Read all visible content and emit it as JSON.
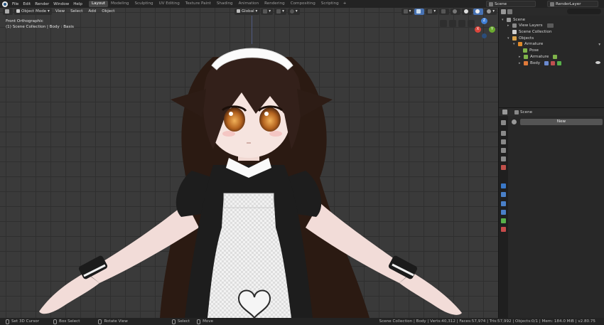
{
  "menu": [
    "File",
    "Edit",
    "Render",
    "Window",
    "Help"
  ],
  "workspaces": [
    {
      "label": "Layout",
      "active": true
    },
    {
      "label": "Modeling"
    },
    {
      "label": "Sculpting"
    },
    {
      "label": "UV Editing"
    },
    {
      "label": "Texture Paint"
    },
    {
      "label": "Shading"
    },
    {
      "label": "Animation"
    },
    {
      "label": "Rendering"
    },
    {
      "label": "Compositing"
    },
    {
      "label": "Scripting"
    }
  ],
  "top_right": {
    "scene": "Scene",
    "view_layer": "RenderLayer"
  },
  "viewport": {
    "mode": "Object Mode",
    "menus": [
      "View",
      "Select",
      "Add",
      "Object"
    ],
    "transform_orientation": "Global",
    "info_line1": "Front Orthographic",
    "info_line2": "(1) Scene Collection | Body : Basis",
    "gizmo": {
      "z": "Z",
      "y": "Y",
      "x": "X"
    }
  },
  "outliner": {
    "rows": [
      {
        "label": "Scene",
        "indent": 0
      },
      {
        "label": "View Layers",
        "indent": 1
      },
      {
        "label": "Scene Collection",
        "indent": 1
      },
      {
        "label": "Objects",
        "indent": 1
      },
      {
        "label": "Armature",
        "indent": 2
      },
      {
        "label": "Pose",
        "indent": 3
      },
      {
        "label": "Armature",
        "indent": 3
      },
      {
        "label": "Body",
        "indent": 3
      }
    ]
  },
  "properties": {
    "title": "Scene",
    "new_button": "New"
  },
  "statusbar": {
    "items": [
      "Set 3D Cursor",
      "Box Select",
      "Rotate View",
      "Select",
      "Move"
    ],
    "stats": "Scene Collection | Body | Verts:40,312 | Faces:57,974 | Tris:57,992 | Objects:0/1 | Mem: 184.0 MiB | v2.80.75"
  },
  "colors": {
    "accent": "#4772b3",
    "axis_x": "#d9453b",
    "axis_y": "#6aaa2f",
    "axis_z": "#3f7fd6"
  }
}
